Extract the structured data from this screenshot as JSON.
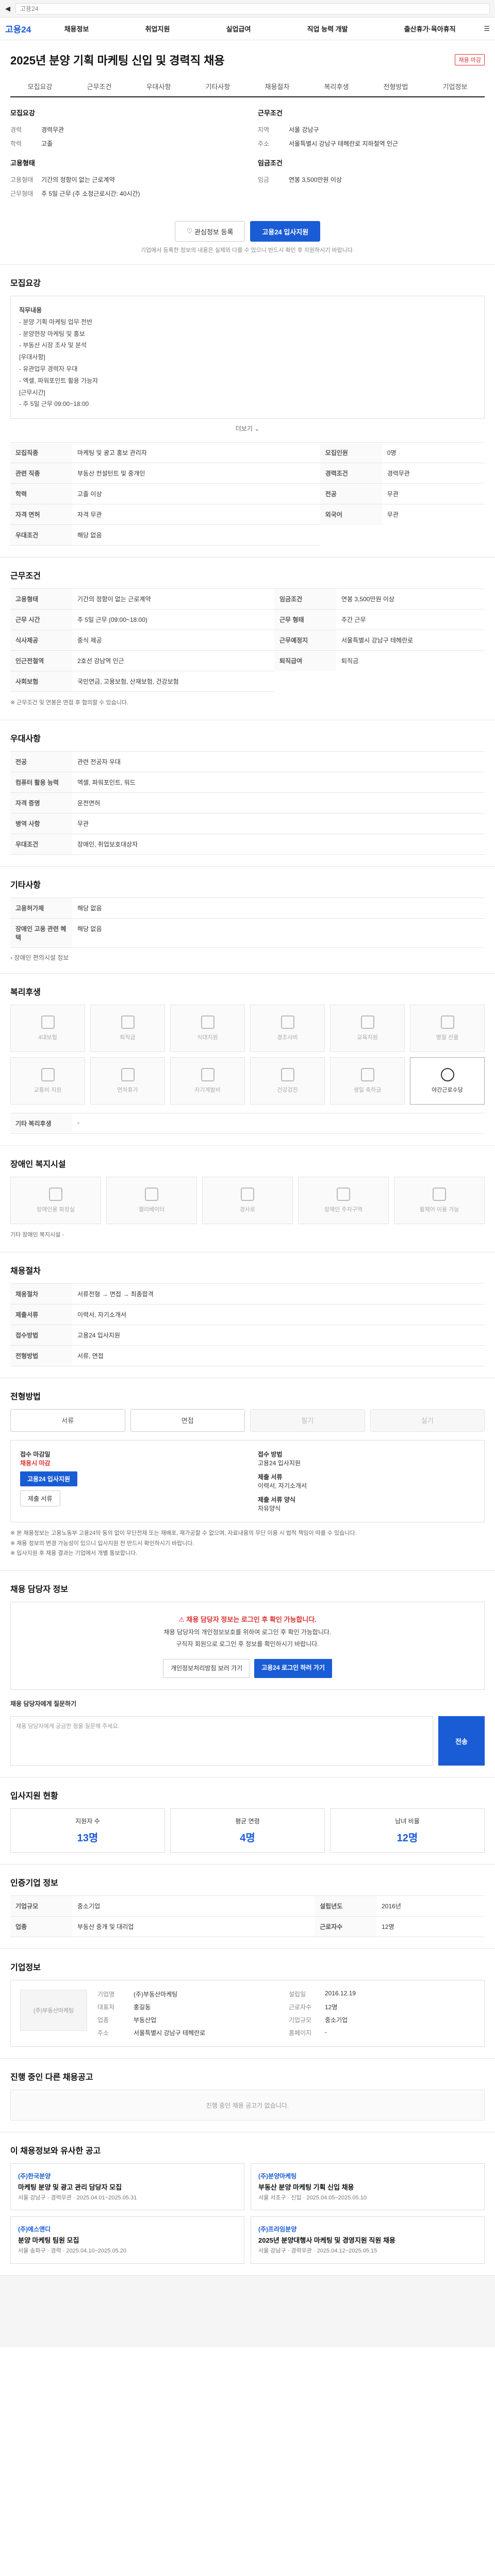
{
  "browser": {
    "url": "고용24"
  },
  "gnb": {
    "logo": "고용24",
    "menu": [
      "채용정보",
      "취업지원",
      "실업급여",
      "직업 능력 개발",
      "출산휴가·육아휴직"
    ]
  },
  "job": {
    "title": "2025년 분양 기획 마케팅 신입 및 경력직 채용",
    "badge": "채용 마감",
    "tabs": [
      "모집요강",
      "근무조건",
      "우대사항",
      "기타사항",
      "채용절차",
      "복리후생",
      "전형방법",
      "기업정보"
    ],
    "left": {
      "heading": "모집요강",
      "rows": [
        [
          "경력",
          "경력무관"
        ],
        [
          "학력",
          "고졸"
        ],
        [
          "",
          ""
        ]
      ],
      "heading2": "고용형태",
      "rows2": [
        [
          "고용형태",
          "기간의 정함이 없는 근로계약"
        ],
        [
          "근무형태",
          "주 5일 근무 (주 소정근로시간: 40시간)"
        ]
      ]
    },
    "right": {
      "heading": "근무조건",
      "rows": [
        [
          "지역",
          "서울 강남구"
        ],
        [
          "주소",
          "서울특별시 강남구 테헤란로 지하철역 인근"
        ],
        [
          "",
          ""
        ]
      ],
      "heading2": "임금조건",
      "rows2": [
        [
          "임금",
          "연봉 3,500만원 이상"
        ]
      ]
    },
    "btn_scrap": "관심정보 등록",
    "btn_apply": "고용24 입사지원",
    "notice": "기업에서 등록한 정보의 내용은 실제와 다를 수 있으니 반드시 확인 후 지원하시기 바랍니다."
  },
  "s1": {
    "title": "모집요강",
    "label": "직무내용",
    "lines": [
      "- 분양 기획 마케팅 업무 전반",
      "- 분양현장 마케팅 및 홍보",
      "- 부동산 시장 조사 및 분석",
      "[우대사항]",
      "- 유관업무 경력자 우대",
      "- 엑셀, 파워포인트 활용 가능자",
      "[근무시간]",
      "- 주 5일 근무 09:00~18:00"
    ],
    "more": "더보기"
  },
  "t1": [
    [
      "모집직종",
      "마케팅 및 광고 홍보 관리자"
    ],
    [
      "모집인원",
      "0명"
    ],
    [
      "관련 직종",
      "부동산 컨설턴트 및 중개인"
    ],
    [
      "경력조건",
      "경력무관"
    ],
    [
      "학력",
      "고졸 이상"
    ],
    [
      "전공",
      "무관"
    ],
    [
      "자격 면허",
      "자격 무관"
    ],
    [
      "외국어",
      "무관"
    ],
    [
      "우대조건",
      "해당 없음"
    ]
  ],
  "s2": {
    "title": "근무조건"
  },
  "t2": [
    [
      "고용형태",
      "기간의 정함이 없는 근로계약"
    ],
    [
      "임금조건",
      "연봉 3,500만원 이상"
    ],
    [
      "근무 시간",
      "주 5일 근무 (09:00~18:00)"
    ],
    [
      "근무 형태",
      "주간 근무"
    ],
    [
      "식사제공",
      "중식 제공"
    ],
    [
      "근무예정지",
      "서울특별시 강남구 테헤란로"
    ],
    [
      "인근전철역",
      "2호선 강남역 인근"
    ],
    [
      "퇴직급여",
      "퇴직금"
    ],
    [
      "사회보험",
      "국민연금, 고용보험, 산재보험, 건강보험"
    ]
  ],
  "t2note": "※ 근무조건 및 연봉은 면접 후 협의할 수 있습니다.",
  "s3": {
    "title": "우대사항"
  },
  "t3": [
    [
      "전공",
      "관련 전공자 우대"
    ],
    [
      "컴퓨터 활용 능력",
      "엑셀, 파워포인트, 워드"
    ],
    [
      "자격 증명",
      "운전면허"
    ],
    [
      "병역 사항",
      "무관"
    ],
    [
      "우대조건",
      "장애인, 취업보호대상자"
    ]
  ],
  "s4": {
    "title": "기타사항"
  },
  "t4": [
    [
      "고용허가제",
      "해당 없음"
    ],
    [
      "장애인 고용 관련 혜택",
      "해당 없음"
    ]
  ],
  "t4link": "장애인 편의시설 정보",
  "s5": {
    "title": "복리후생"
  },
  "welfare": [
    "4대보험",
    "퇴직금",
    "식대지원",
    "경조사비",
    "교육지원",
    "명절 선물",
    "교통비 지원",
    "연차휴가",
    "자기계발비",
    "건강검진",
    "생일 축하금",
    "야간근로수당"
  ],
  "welfare_on": [
    11
  ],
  "welfare_etc_label": "기타 복리후생",
  "welfare_etc": "-",
  "s6": {
    "title": "장애인 복지시설"
  },
  "facilities": [
    "장애인용 화장실",
    "엘리베이터",
    "경사로",
    "장애인 주차구역",
    "휠체어 이용 가능"
  ],
  "facilities_note": "기타 장애인 복지시설 -",
  "s7": {
    "title": "채용절차"
  },
  "t7": [
    [
      "채용절차",
      "서류전형 → 면접 → 최종합격"
    ],
    [
      "제출서류",
      "이력서, 자기소개서"
    ],
    [
      "접수방법",
      "고용24 입사지원"
    ],
    [
      "전형방법",
      "서류, 면접"
    ]
  ],
  "s8": {
    "title": "전형방법"
  },
  "methods": [
    "서류",
    "면접",
    "필기",
    "실기"
  ],
  "methods_dis": [
    2,
    3
  ],
  "apply": {
    "h1": "접수 마감일",
    "d1": "채용시 마감",
    "h2": "접수 방법",
    "d2": "고용24 입사지원",
    "btn1": "고용24 입사지원",
    "btn2": "제출 서류",
    "h3": "제출 서류",
    "d3": "이력서, 자기소개서",
    "h4": "제출 서류 양식",
    "d4": "자유양식"
  },
  "apply_notes": [
    "※ 본 채용정보는 고용노동부 고용24의 동의 없이 무단전재 또는 재배포, 재가공할 수 없으며, 자료내용의 무단 이용 시 법적 책임이 따를 수 있습니다.",
    "※ 채용 정보의 변경 가능성이 있으니 입사지원 전 반드시 확인하시기 바랍니다.",
    "※ 입사지원 후 채용 결과는 기업에서 개별 통보합니다."
  ],
  "s9": {
    "title": "채용 담당자 정보"
  },
  "warn": {
    "t": "채용 담당자 정보는 로그인 후 확인 가능합니다.",
    "l1": "채용 담당자의 개인정보보호를 위하여 로그인 후 확인 가능합니다.",
    "l2": "구직자 회원으로 로그인 후 정보를 확인하시기 바랍니다.",
    "b1": "개인정보처리방침 보러 가기",
    "b2": "고용24 로그인 하러 가기"
  },
  "qa": {
    "label": "채용 담당자에게 질문하기",
    "placeholder": "채용 담당자에게 궁금한 점을 질문해 주세요.",
    "send": "전송"
  },
  "s10": {
    "title": "입사지원 현황"
  },
  "stats": [
    [
      "지원자 수",
      "13명"
    ],
    [
      "평균 연령",
      "4명"
    ],
    [
      "남녀 비율",
      "12명"
    ]
  ],
  "s11": {
    "title": "인증기업 정보"
  },
  "t11": [
    [
      "기업규모",
      "중소기업"
    ],
    [
      "설립년도",
      "2016년"
    ],
    [
      "업종",
      "부동산 중개 및 대리업"
    ],
    [
      "근로자수",
      "12명"
    ]
  ],
  "s12": {
    "title": "기업정보",
    "name": "(주)부동산마케팅",
    "rows": [
      [
        "기업명",
        "(주)부동산마케팅"
      ],
      [
        "설립일",
        "2016.12.19"
      ],
      [
        "대표자",
        "홍길동"
      ],
      [
        "근로자수",
        "12명"
      ],
      [
        "업종",
        "부동산업"
      ],
      [
        "기업규모",
        "중소기업"
      ],
      [
        "주소",
        "서울특별시 강남구 테헤란로"
      ],
      [
        "홈페이지",
        "-"
      ]
    ]
  },
  "s13": {
    "title": "진행 중인 다른 채용공고",
    "empty": "진행 중인 채용 공고가 없습니다."
  },
  "s14": {
    "title": "이 채용정보와 유사한 공고"
  },
  "cards": [
    {
      "co": "(주)한국분양",
      "tt": "마케팅 분양 및 광고 관리 담당자 모집",
      "meta": "서울 강남구 · 경력무관 · 2025.04.01~2025.05.31"
    },
    {
      "co": "(주)분양마케팅",
      "tt": "부동산 분양 마케팅 기획 신입 채용",
      "meta": "서울 서초구 · 신입 · 2025.04.05~2025.05.10"
    },
    {
      "co": "(주)에스앤디",
      "tt": "분양 마케팅 팀원 모집",
      "meta": "서울 송파구 · 경력 · 2025.04.10~2025.05.20"
    },
    {
      "co": "(주)프라임분양",
      "tt": "2025년 분양대행사 마케팅 및 경영지원 직원 채용",
      "meta": "서울 강남구 · 경력무관 · 2025.04.12~2025.05.15"
    }
  ]
}
